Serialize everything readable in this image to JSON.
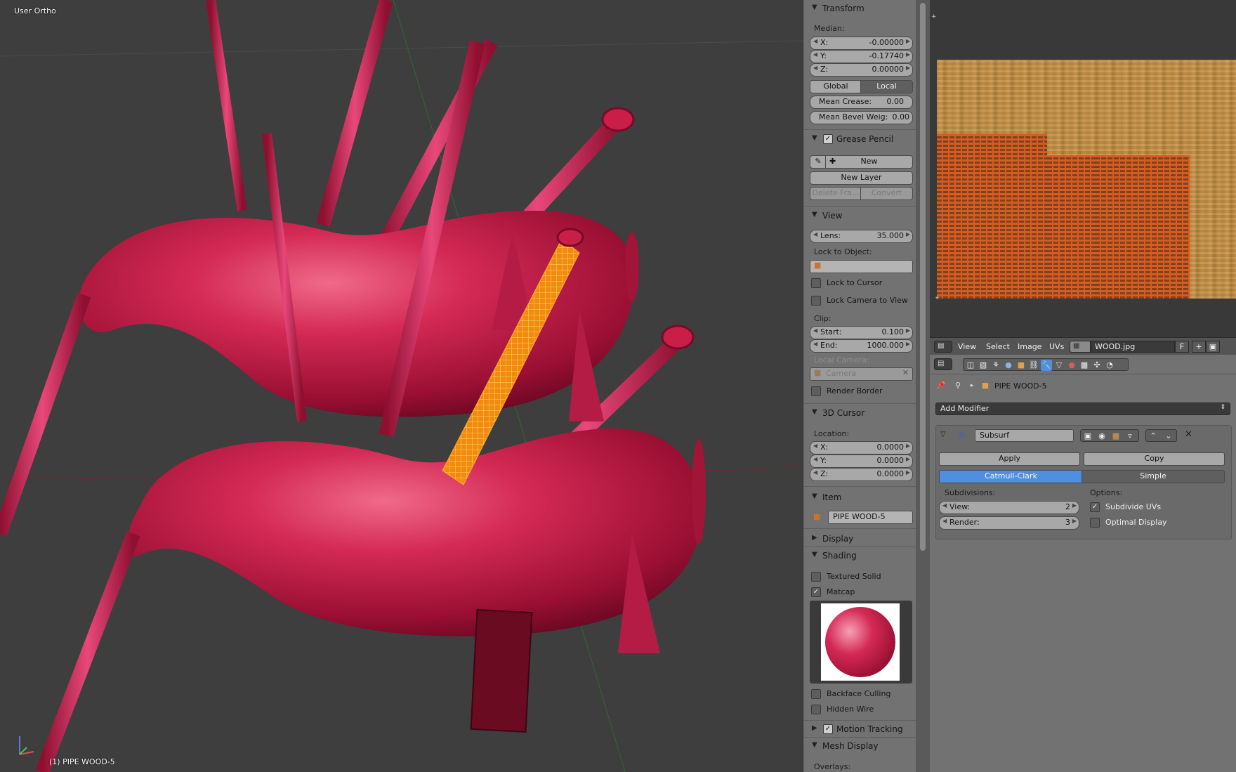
{
  "viewport": {
    "view_label": "User Ortho",
    "object_label": "(1) PIPE WOOD-5"
  },
  "npanel": {
    "transform": {
      "title": "Transform",
      "median_label": "Median:",
      "x_label": "X:",
      "x_value": "-0.00000",
      "y_label": "Y:",
      "y_value": "-0.17740",
      "z_label": "Z:",
      "z_value": "0.00000",
      "global_label": "Global",
      "local_label": "Local",
      "mean_crease_label": "Mean Crease:",
      "mean_crease_value": "0.00",
      "mean_bevel_label": "Mean Bevel Weig:",
      "mean_bevel_value": "0.00"
    },
    "grease_pencil": {
      "title": "Grease Pencil",
      "new_label": "New",
      "new_layer_label": "New Layer",
      "delete_frame_label": "Delete Fra...",
      "convert_label": "Convert"
    },
    "view": {
      "title": "View",
      "lens_label": "Lens:",
      "lens_value": "35.000",
      "lock_to_object_label": "Lock to Object:",
      "lock_to_cursor_label": "Lock to Cursor",
      "lock_camera_label": "Lock Camera to View",
      "clip_label": "Clip:",
      "start_label": "Start:",
      "start_value": "0.100",
      "end_label": "End:",
      "end_value": "1000.000",
      "local_camera_label": "Local Camera:",
      "camera_placeholder": "Camera",
      "render_border_label": "Render Border"
    },
    "cursor": {
      "title": "3D Cursor",
      "location_label": "Location:",
      "x_label": "X:",
      "x_value": "0.0000",
      "y_label": "Y:",
      "y_value": "0.0000",
      "z_label": "Z:",
      "z_value": "0.0000"
    },
    "item": {
      "title": "Item",
      "name_value": "PIPE WOOD-5"
    },
    "display_title": "Display",
    "shading": {
      "title": "Shading",
      "textured_solid_label": "Textured Solid",
      "matcap_label": "Matcap",
      "backface_culling_label": "Backface Culling",
      "hidden_wire_label": "Hidden Wire"
    },
    "motion_tracking_title": "Motion Tracking",
    "mesh_display": {
      "title": "Mesh Display",
      "overlays_label": "Overlays:"
    }
  },
  "image_editor": {
    "menus": [
      "View",
      "Select",
      "Image",
      "UVs"
    ],
    "image_name": "WOOD.jpg",
    "fake_user_label": "F"
  },
  "properties": {
    "object_name": "PIPE WOOD-5",
    "add_modifier_label": "Add Modifier",
    "modifier": {
      "name_value": "Subsurf",
      "apply_label": "Apply",
      "copy_label": "Copy",
      "catmull_label": "Catmull-Clark",
      "simple_label": "Simple",
      "subdivisions_label": "Subdivisions:",
      "view_label": "View:",
      "view_value": "2",
      "render_label": "Render:",
      "render_value": "3",
      "options_label": "Options:",
      "subdivide_uvs_label": "Subdivide UVs",
      "optimal_display_label": "Optimal Display"
    }
  },
  "colors": {
    "bag": "#c81e48",
    "selection": "#ff9a1a",
    "active_button": "#4f8ee0",
    "panel_bg": "#727272"
  }
}
